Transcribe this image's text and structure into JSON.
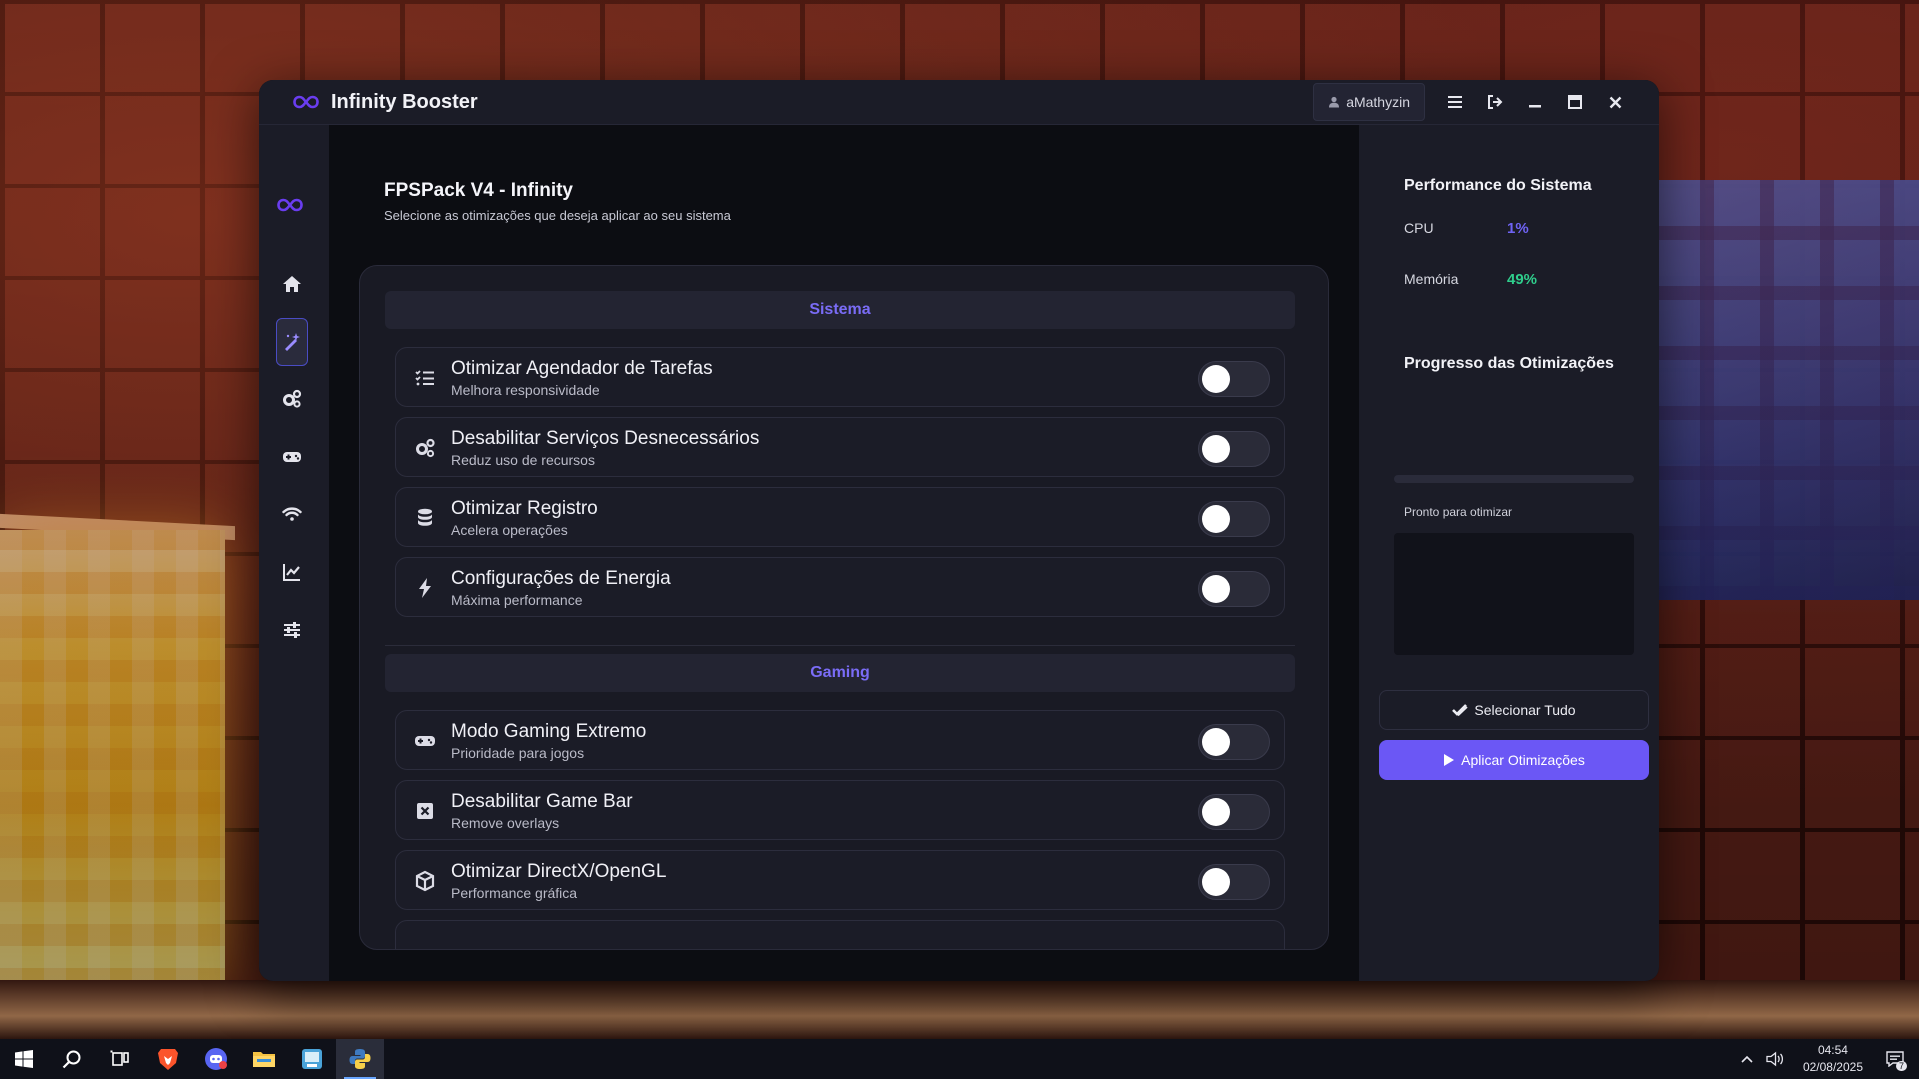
{
  "window": {
    "title": "Infinity Booster",
    "user": "aMathyzin"
  },
  "main": {
    "title": "FPSPack V4 - Infinity",
    "subtitle": "Selecione as otimizações que deseja aplicar ao seu sistema",
    "sections": [
      {
        "title": "Sistema",
        "items": [
          {
            "title": "Otimizar Agendador de Tarefas",
            "desc": "Melhora responsividade",
            "icon": "list-check-icon",
            "enabled": false
          },
          {
            "title": "Desabilitar Serviços Desnecessários",
            "desc": "Reduz uso de recursos",
            "icon": "cogs-icon",
            "enabled": false
          },
          {
            "title": "Otimizar Registro",
            "desc": "Acelera operações",
            "icon": "database-icon",
            "enabled": false
          },
          {
            "title": "Configurações de Energia",
            "desc": "Máxima performance",
            "icon": "bolt-icon",
            "enabled": false
          }
        ]
      },
      {
        "title": "Gaming",
        "items": [
          {
            "title": "Modo Gaming Extremo",
            "desc": "Prioridade para jogos",
            "icon": "gamepad-icon",
            "enabled": false
          },
          {
            "title": "Desabilitar Game Bar",
            "desc": "Remove overlays",
            "icon": "square-x-icon",
            "enabled": false
          },
          {
            "title": "Otimizar DirectX/OpenGL",
            "desc": "Performance gráfica",
            "icon": "cube-icon",
            "enabled": false
          }
        ]
      }
    ]
  },
  "right": {
    "performance_title": "Performance do Sistema",
    "cpu_label": "CPU",
    "cpu_value": "1%",
    "cpu_color": "#6f63f4",
    "memory_label": "Memória",
    "memory_value": "49%",
    "memory_color": "#2fce8c",
    "progress_title": "Progresso das Otimizações",
    "progress_fraction": 0,
    "status": "Pronto para otimizar",
    "select_all": "Selecionar Tudo",
    "apply": "Aplicar Otimizações"
  },
  "colors": {
    "accent": "#6b57f5",
    "section_title": "#7a6cf6"
  },
  "taskbar": {
    "time": "04:54",
    "date": "02/08/2025",
    "notification_count": "7"
  }
}
